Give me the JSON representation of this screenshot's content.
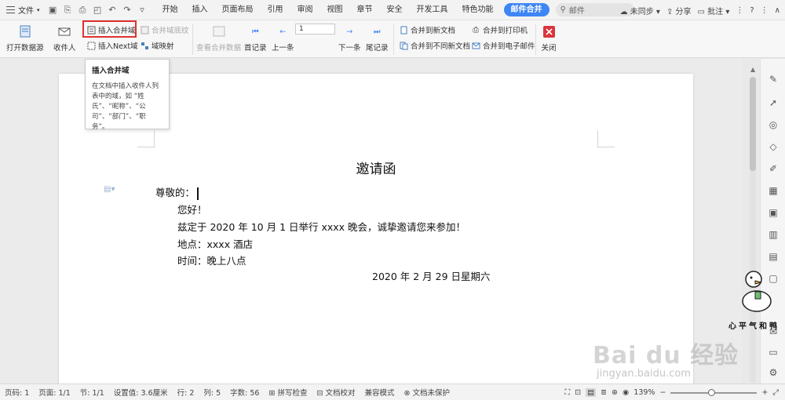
{
  "menu": {
    "file_label": "文件",
    "tabs": [
      "开始",
      "插入",
      "页面布局",
      "引用",
      "审阅",
      "视图",
      "章节",
      "安全",
      "开发工具",
      "特色功能",
      "邮件合并"
    ],
    "active_tab": "邮件合并",
    "search_text": "邮件",
    "sync_label": "未同步",
    "share_label": "分享",
    "comment_label": "批注"
  },
  "ribbon": {
    "open_source": "打开数据源",
    "recipients": "收件人",
    "insert_merge_field": "插入合并域",
    "merge_field_shading": "合并域底纹",
    "insert_next_field": "插入Next域",
    "field_mapping": "域映射",
    "view_merged_data": "查看合并数据",
    "first_record": "首记录",
    "prev_record": "上一条",
    "record_number": "1",
    "next_record": "下一条",
    "last_record": "尾记录",
    "merge_new_doc": "合并到新文档",
    "merge_diff_doc": "合并到不同新文档",
    "merge_printer": "合并到打印机",
    "merge_email": "合并到电子邮件",
    "close": "关闭"
  },
  "tooltip": {
    "title": "插入合并域",
    "body": "在文档中插入收件人列表中的域，如 “姓氏”、“昵称”、“公司”、“部门”、“职务”。"
  },
  "document": {
    "title": "邀请函",
    "greeting": "尊敬的：",
    "hello": "您好！",
    "body": "兹定于 2020 年 10 月 1 日举行 xxxx 晚会，诚挚邀请您来参加！",
    "location": "地点：xxxx 酒店",
    "time": "时间：晚上八点",
    "date": "2020 年 2 月 29 日星期六"
  },
  "watermark": {
    "baidu": "Bai du 经验",
    "url": "jingyan.baidu.com",
    "signature": "心平气和鸭"
  },
  "status": {
    "page_no": "页码: 1",
    "pages": "页面: 1/1",
    "section": "节: 1/1",
    "position": "设置值: 3.6厘米",
    "row": "行: 2",
    "col": "列: 5",
    "words": "字数: 56",
    "spell": "拼写检查",
    "proofread": "文档校对",
    "compat": "兼容模式",
    "protect": "文档未保护",
    "zoom": "139%"
  },
  "colors": {
    "accent": "#3e86f5",
    "highlight": "#e03030"
  },
  "progress": {
    "zoom_fraction": 0.46
  }
}
